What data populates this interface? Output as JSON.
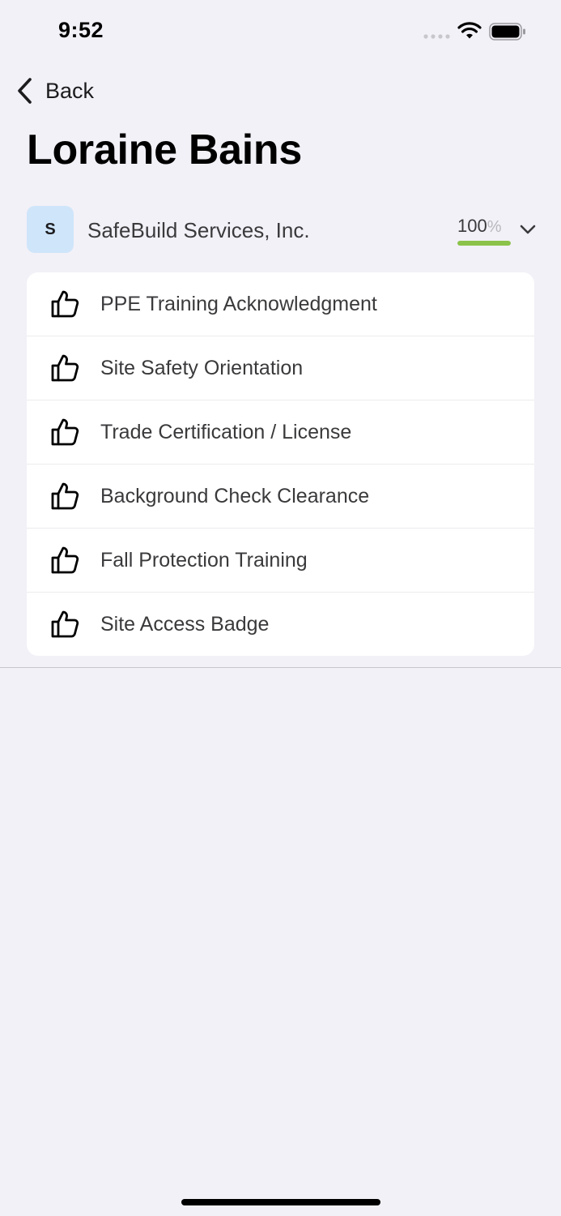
{
  "status_bar": {
    "time": "9:52"
  },
  "nav": {
    "back_label": "Back"
  },
  "page": {
    "title": "Loraine Bains"
  },
  "company": {
    "avatar_letter": "S",
    "name": "SafeBuild Services, Inc.",
    "progress_value": "100",
    "progress_unit": "%",
    "progress_fraction": 1.0,
    "progress_color": "#8bc34a"
  },
  "requirements": [
    {
      "label": "PPE Training Acknowledgment",
      "icon": "thumbs-up-icon"
    },
    {
      "label": "Site Safety Orientation",
      "icon": "thumbs-up-icon"
    },
    {
      "label": "Trade Certification / License",
      "icon": "thumbs-up-icon"
    },
    {
      "label": "Background Check Clearance",
      "icon": "thumbs-up-icon"
    },
    {
      "label": "Fall Protection Training",
      "icon": "thumbs-up-icon"
    },
    {
      "label": "Site Access Badge",
      "icon": "thumbs-up-icon"
    }
  ]
}
